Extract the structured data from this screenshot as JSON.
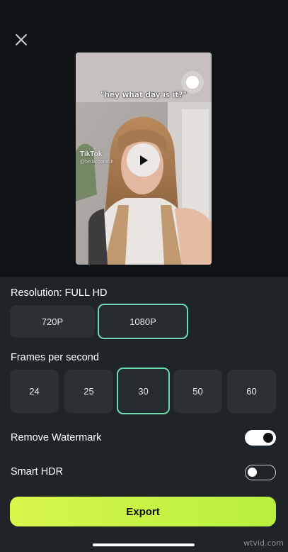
{
  "preview": {
    "caption": "\"hey what day is it?\"",
    "tiktok_logo": "TikTok",
    "tiktok_user": "@bellaccomish"
  },
  "resolution": {
    "label": "Resolution: FULL HD",
    "options": [
      "720P",
      "1080P"
    ],
    "selected": "1080P"
  },
  "fps": {
    "label": "Frames per second",
    "options": [
      "24",
      "25",
      "30",
      "50",
      "60"
    ],
    "selected": "30"
  },
  "remove_watermark": {
    "label": "Remove Watermark",
    "on": true
  },
  "smart_hdr": {
    "label": "Smart HDR",
    "on": false
  },
  "export": {
    "label": "Export"
  },
  "site_watermark": "wtvid.com",
  "colors": {
    "accent_border": "#6fd9ae",
    "export_bg": "#c9f445",
    "panel_bg": "#1f2428",
    "option_bg": "#2b3034"
  }
}
